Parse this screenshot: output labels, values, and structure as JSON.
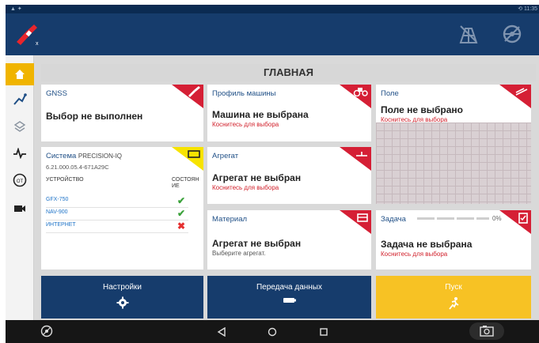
{
  "status": {
    "left": "▲ ✦",
    "right": "⟲ 11:35"
  },
  "colors": {
    "primary": "#163c6c",
    "accent": "#f0b400",
    "alert": "#d51f35",
    "ok": "#3ba23b"
  },
  "page_title": "ГЛАВНАЯ",
  "gnss": {
    "header": "GNSS",
    "main": "Выбор не выполнен"
  },
  "machine": {
    "header": "Профиль машины",
    "main": "Машина не выбрана",
    "sub": "Коснитесь для выбора"
  },
  "field": {
    "header": "Поле",
    "main": "Поле не выбрано",
    "sub": "Коснитесь для выбора"
  },
  "system": {
    "header": "Система",
    "name": "PRECISION-IQ",
    "version": "6.21.000.05.4-671A29C",
    "col_device": "УСТРОЙСТВО",
    "col_state_1": "СОСТОЯН",
    "col_state_2": "ИЕ",
    "devices": [
      {
        "name": "GFX-750",
        "state": "✔"
      },
      {
        "name": "NAV-900",
        "state": "✔"
      },
      {
        "name": "ИНТЕРНЕТ",
        "state": "✖"
      }
    ]
  },
  "implement": {
    "header": "Агрегат",
    "main": "Агрегат не выбран",
    "sub": "Коснитесь для выбора"
  },
  "material": {
    "header": "Материал",
    "main": "Агрегат не выбран",
    "sub": "Выберите агрегат."
  },
  "task": {
    "header": "Задача",
    "percent": "0%",
    "main": "Задача не выбрана",
    "sub": "Коснитесь для выбора"
  },
  "buttons": {
    "settings": "Настройки",
    "transfer": "Передача данных",
    "start": "Пуск"
  },
  "icons": {
    "logo": "satellite-logo-icon",
    "field_map": "field-icon",
    "steering": "steering-wheel-icon",
    "home": "home-icon",
    "guidance": "guidance-icon",
    "layers": "layers-icon",
    "signal": "signal-icon",
    "rate": "rate-icon",
    "camera": "camera-icon"
  }
}
